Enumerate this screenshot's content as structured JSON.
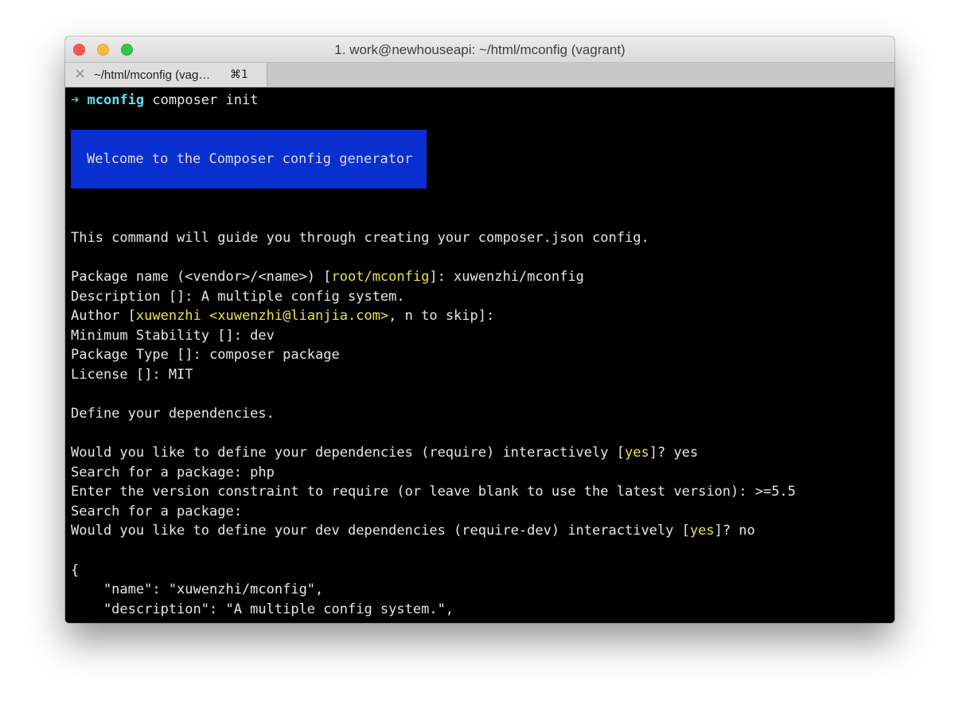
{
  "window": {
    "title": "1. work@newhouseapi: ~/html/mconfig (vagrant)"
  },
  "tab": {
    "close_icon": "×",
    "label": "~/html/mconfig (vag…",
    "shortcut": "⌘1"
  },
  "terminal": {
    "prompt_arrow": "➜",
    "prompt_dir": "mconfig",
    "command": " composer init",
    "banner_text": "Welcome to the Composer config generator",
    "intro": "This command will guide you through creating your composer.json config.",
    "package_name_prefix": "Package name (<vendor>/<name>) [",
    "package_name_default": "root/mconfig",
    "package_name_suffix": "]: xuwenzhi/mconfig",
    "description_line": "Description []: A multiple config system.",
    "author_prefix": "Author [",
    "author_default": "xuwenzhi <xuwenzhi@lianjia.com>",
    "author_suffix": ", n to skip]:",
    "stability_line": "Minimum Stability []: dev",
    "type_line": "Package Type []: composer package",
    "license_line": "License []: MIT",
    "define_deps": "Define your dependencies.",
    "require_prefix": "Would you like to define your dependencies (require) interactively [",
    "require_default": "yes",
    "require_suffix": "]? yes",
    "search1": "Search for a package: php",
    "version_constraint": "Enter the version constraint to require (or leave blank to use the latest version): >=5.5",
    "search2": "Search for a package:",
    "dev_prefix": "Would you like to define your dev dependencies (require-dev) interactively [",
    "dev_default": "yes",
    "dev_suffix": "]? no",
    "json_open": "{",
    "json_name": "    \"name\": \"xuwenzhi/mconfig\",",
    "json_description": "    \"description\": \"A multiple config system.\","
  },
  "colors": {
    "prompt_arrow": "#56d958",
    "prompt_dir": "#5ce0f0",
    "highlight": "#e9e04e",
    "banner_bg": "#0a2fd1",
    "text": "#e6e6e6",
    "background": "#000000"
  }
}
